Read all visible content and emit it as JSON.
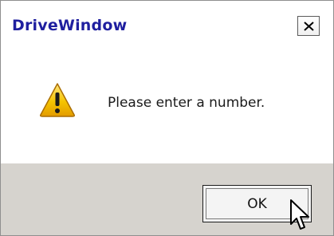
{
  "window": {
    "title": "DriveWindow",
    "close_icon": "close-icon"
  },
  "message": {
    "icon": "warning-icon",
    "text": "Please enter a number."
  },
  "buttons": {
    "ok_label": "OK"
  },
  "colors": {
    "title_text": "#1f1f9f",
    "button_bar": "#d6d3ce",
    "warning_yellow": "#f5c400"
  }
}
